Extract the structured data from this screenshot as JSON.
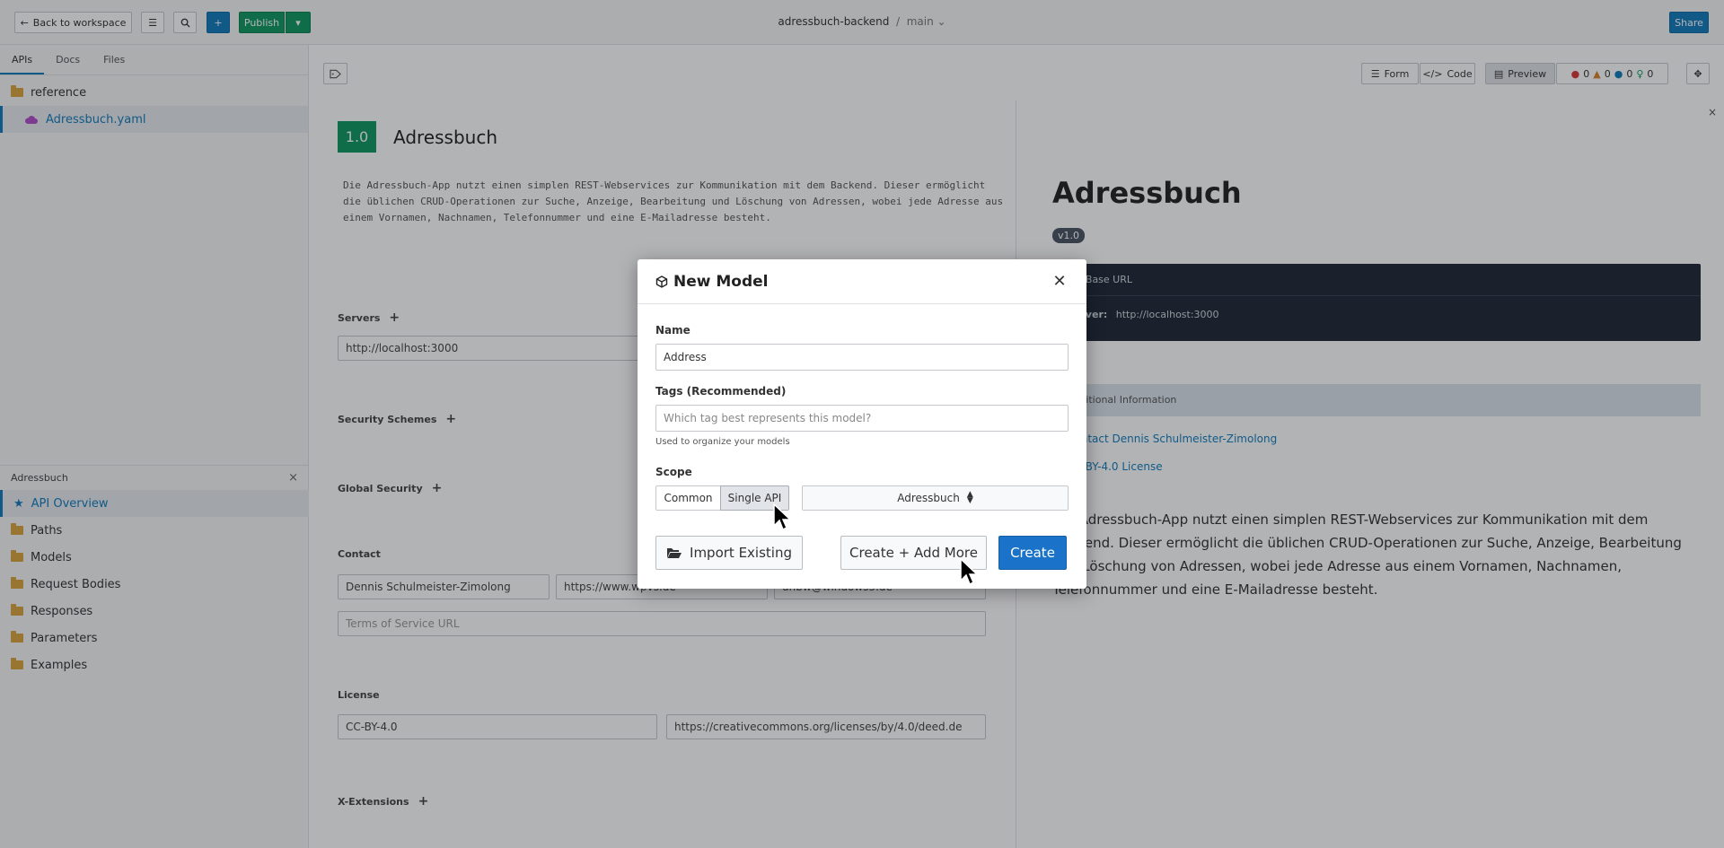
{
  "topbar": {
    "back_label": "Back to workspace",
    "publish_label": "Publish",
    "project": "adressbuch-backend",
    "separator": "/",
    "branch": "main",
    "share_label": "Share"
  },
  "sidebar": {
    "tabs": [
      "APIs",
      "Docs",
      "Files"
    ],
    "tree": [
      {
        "label": "reference",
        "icon": "folder-icon"
      },
      {
        "label": "Adressbuch.yaml",
        "icon": "cloud-icon",
        "selected": true
      }
    ],
    "panel_title": "Adressbuch",
    "panel_items": [
      {
        "label": "API Overview",
        "icon": "star-icon",
        "selected": true
      },
      {
        "label": "Paths",
        "icon": "folder-icon"
      },
      {
        "label": "Models",
        "icon": "folder-icon"
      },
      {
        "label": "Request Bodies",
        "icon": "folder-icon"
      },
      {
        "label": "Responses",
        "icon": "folder-icon"
      },
      {
        "label": "Parameters",
        "icon": "folder-icon"
      },
      {
        "label": "Examples",
        "icon": "folder-icon"
      }
    ]
  },
  "toolbar": {
    "form_label": "Form",
    "code_label": "Code",
    "preview_label": "Preview",
    "counts": [
      "0",
      "0",
      "0",
      "0"
    ]
  },
  "editor": {
    "version": "1.0",
    "title": "Adressbuch",
    "description": "Die Adressbuch-App nutzt einen simplen REST-Webservices zur Kommunikation mit dem Backend. Dieser ermöglicht die üblichen CRUD-Operationen zur Suche, Anzeige, Bearbeitung und Löschung von Adressen, wobei jede Adresse aus einem Vornamen, Nachnamen, Telefonnummer und eine E-Mailadresse besteht.",
    "servers_label": "Servers",
    "server_url": "http://localhost:3000",
    "security_schemes_label": "Security Schemes",
    "global_security_label": "Global Security",
    "contact_label": "Contact",
    "contact_name": "Dennis Schulmeister-Zimolong",
    "contact_url": "https://www.wpvs.de",
    "contact_email": "dhbw@windows3.de",
    "tos_placeholder": "Terms of Service URL",
    "license_label": "License",
    "license_name": "CC-BY-4.0",
    "license_url": "https://creativecommons.org/licenses/by/4.0/deed.de",
    "x_extensions_label": "X-Extensions"
  },
  "preview": {
    "title": "Adressbuch",
    "version": "v1.0",
    "base_url_label": "API Base URL",
    "server_label": "Server:",
    "server_url": "http://localhost:3000",
    "additional_info": "Additional Information",
    "contact_link": "Contact Dennis Schulmeister-Zimolong",
    "license_link": "CC-BY-4.0 License",
    "description": "Die Adressbuch-App nutzt einen simplen REST-Webservices zur Kommunikation mit dem Backend. Dieser ermöglicht die üblichen CRUD-Operationen zur Suche, Anzeige, Bearbeitung und Löschung von Adressen, wobei jede Adresse aus einem Vornamen, Nachnamen, Telefonnummer und eine E-Mailadresse besteht."
  },
  "modal": {
    "title": "New Model",
    "name_label": "Name",
    "name_value": "Address",
    "tags_label": "Tags (Recommended)",
    "tags_placeholder": "Which tag best represents this model?",
    "tags_hint": "Used to organize your models",
    "scope_label": "Scope",
    "scope_options": [
      "Common",
      "Single API"
    ],
    "scope_selected": "Single API",
    "api_select_value": "Adressbuch",
    "import_label": "Import Existing",
    "create_add_more_label": "Create + Add More",
    "create_label": "Create"
  },
  "colors": {
    "accent": "#137cbd",
    "primary_button": "#1a73c8",
    "publish": "#0f9960",
    "version_badge": "#0f9960"
  }
}
